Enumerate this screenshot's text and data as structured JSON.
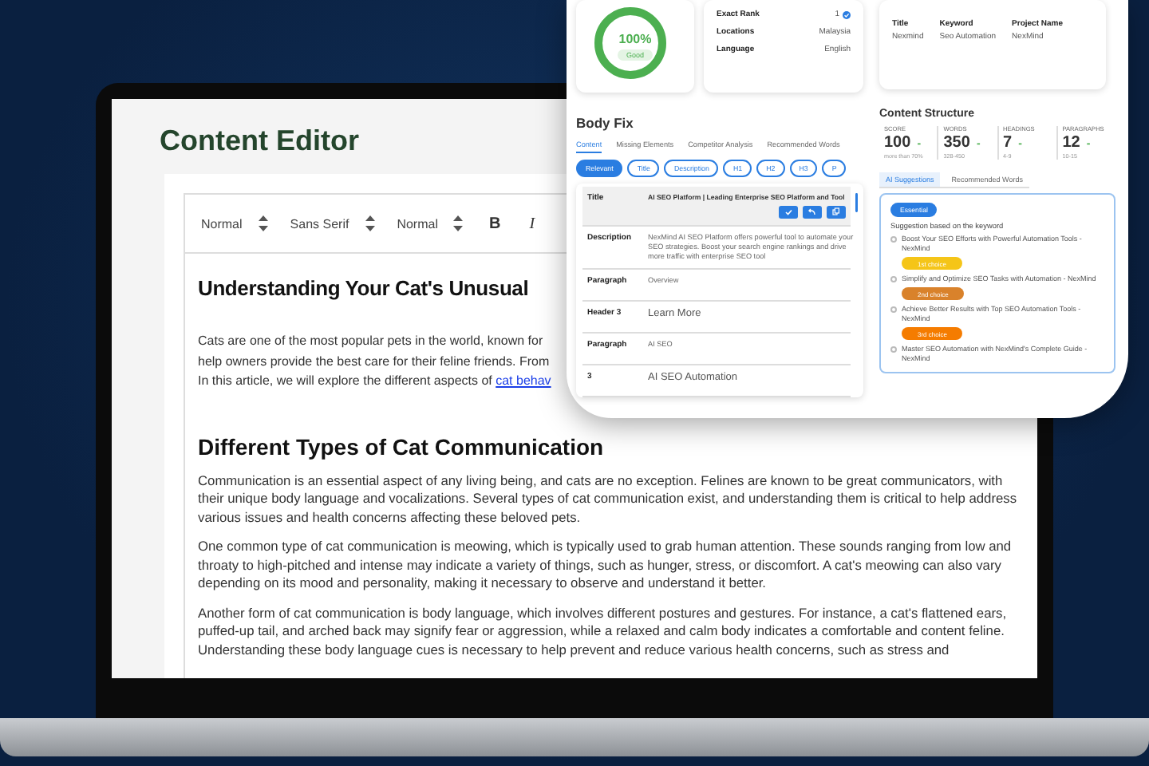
{
  "editor": {
    "title": "Content Editor",
    "toolbar": [
      {
        "kind": "select",
        "label": "Normal"
      },
      {
        "kind": "select",
        "label": "Sans Serif"
      },
      {
        "kind": "select",
        "label": "Normal"
      },
      {
        "kind": "bold",
        "label": "B"
      },
      {
        "kind": "italic",
        "label": "I"
      }
    ],
    "heading": "Understanding Your Cat's Unusual",
    "intro_lines": [
      "Cats are one of the most popular pets in the world, known for",
      "help owners provide the best care for their feline friends. From",
      "In this article, we will explore the different aspects of "
    ],
    "intro_link": "cat behav",
    "section_heading": "Different Types of Cat Communication",
    "paragraphs": [
      "Communication is an essential aspect of any living being, and cats are no exception. Felines are known to be great communicators, with their unique body language and vocalizations. Several types of cat communication exist, and understanding them is critical to help address various issues and health concerns affecting these beloved pets.",
      "One common type of cat communication is meowing, which is typically used to grab human attention. These sounds ranging from low and throaty to high-pitched and intense may indicate a variety of things, such as hunger, stress, or discomfort. A cat's meowing can also vary depending on its mood and personality, making it necessary to observe and understand it better.",
      "Another form of cat communication is body language, which involves different postures and gestures. For instance, a cat's flattened ears, puffed-up tail, and arched back may signify fear or aggression, while a relaxed and calm body indicates a comfortable and content feline. Understanding these body language cues is necessary to help prevent and reduce various health concerns, such as stress and"
    ]
  },
  "seo_panel": {
    "score": {
      "value": "100%",
      "label": "Good",
      "level": 1
    },
    "rank_info": [
      {
        "label": "Exact Rank",
        "value": "1"
      },
      {
        "label": "Locations",
        "value": "Malaysia"
      },
      {
        "label": "Language",
        "value": "English"
      }
    ],
    "project": [
      {
        "label": "Title",
        "value": "Nexmind"
      },
      {
        "label": "Keyword",
        "value": "Seo Automation"
      },
      {
        "label": "Project Name",
        "value": "NexMind"
      }
    ],
    "body_fix": {
      "title": "Body Fix",
      "tabs": [
        {
          "label": "Content",
          "selected": true
        },
        {
          "label": "Missing Elements",
          "selected": false
        },
        {
          "label": "Competitor Analysis",
          "selected": false
        },
        {
          "label": "Recommended Words",
          "selected": false
        }
      ],
      "filters": [
        {
          "label": "Relevant",
          "selected": true
        },
        {
          "label": "Title",
          "selected": false
        },
        {
          "label": "Description",
          "selected": false
        },
        {
          "label": "H1",
          "selected": false
        },
        {
          "label": "H2",
          "selected": false
        },
        {
          "label": "H3",
          "selected": false
        },
        {
          "label": "P",
          "selected": false
        }
      ],
      "rows": [
        {
          "label": "Title",
          "value": "AI SEO Platform | Leading Enterprise SEO Platform and Tool",
          "selected": true
        },
        {
          "label": "Description",
          "value": "NexMind AI SEO Platform offers powerful tool to automate your SEO strategies. Boost your search engine rankings and drive more traffic with enterprise SEO tool",
          "selected": false
        },
        {
          "label": "Paragraph",
          "value": "Overview",
          "selected": false
        },
        {
          "label": "Header 3",
          "value": "Learn More",
          "selected": false
        },
        {
          "label": "Paragraph",
          "value": "AI SEO",
          "selected": false
        },
        {
          "label": "3",
          "value": "AI SEO Automation",
          "selected": false
        }
      ]
    },
    "content_structure": {
      "title": "Content Structure",
      "metrics": [
        {
          "label": "SCORE",
          "value": "100",
          "mark": "-",
          "range": "more than 70%"
        },
        {
          "label": "WORDS",
          "value": "350",
          "mark": "-",
          "range": "328-450"
        },
        {
          "label": "HEADINGS",
          "value": "7",
          "mark": "-",
          "range": "4-9"
        },
        {
          "label": "PARAGRAPHS",
          "value": "12",
          "mark": "-",
          "range": "10-15"
        }
      ]
    },
    "suggestions": {
      "tabs": [
        {
          "label": "AI Suggestions",
          "selected": true
        },
        {
          "label": "Recommended Words",
          "selected": false
        }
      ],
      "badge": "Essential",
      "caption": "Suggestion based on the keyword",
      "items": [
        {
          "text": "Boost Your SEO Efforts with Powerful Automation Tools - NexMind",
          "badge": "1st choice",
          "color": "#f5c518",
          "selected": false
        },
        {
          "text": "Simplify and Optimize SEO Tasks with Automation - NexMind",
          "badge": "2nd choice",
          "color": "#d9822b",
          "selected": false
        },
        {
          "text": "Achieve Better Results with Top SEO Automation Tools - NexMind",
          "badge": "3rd choice",
          "color": "#f57c00",
          "selected": false
        },
        {
          "text": "Master SEO Automation with NexMind's Complete Guide - NexMind",
          "selected": false
        }
      ]
    }
  }
}
